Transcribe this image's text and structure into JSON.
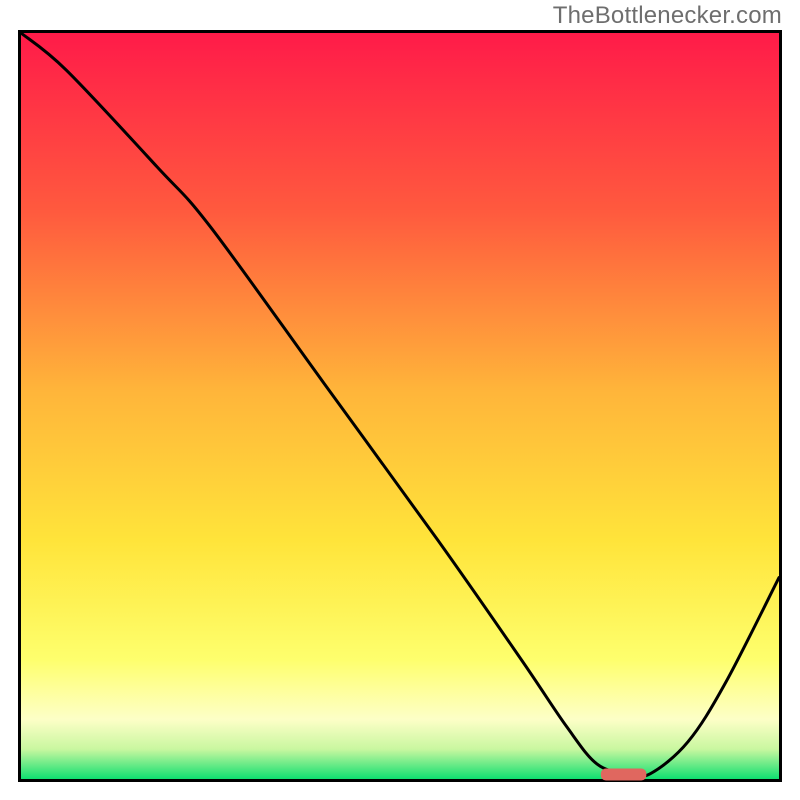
{
  "attribution": "TheBottlenecker.com",
  "chart_data": {
    "type": "line",
    "title": "",
    "xlabel": "",
    "ylabel": "",
    "xlim": [
      0,
      100
    ],
    "ylim": [
      0,
      100
    ],
    "gradient_colors": {
      "top": "#ff1b49",
      "mid_upper": "#ffa63a",
      "mid": "#ffe83a",
      "mid_lower": "#feff9a",
      "bottom": "#0fdf70"
    },
    "series": [
      {
        "name": "curve",
        "x": [
          0,
          6,
          18,
          25,
          40,
          55,
          66,
          72,
          76,
          80,
          83,
          88,
          93,
          100
        ],
        "y": [
          100,
          95,
          82,
          74,
          53,
          32,
          16,
          7,
          2,
          0.7,
          0.7,
          5,
          13,
          27
        ]
      }
    ],
    "flat_segment": {
      "x_start": 76,
      "x_end": 83,
      "y": 0.7
    },
    "marker": {
      "x_start": 76.5,
      "x_end": 82.5,
      "y": 0.6,
      "color": "#e0675f"
    }
  }
}
